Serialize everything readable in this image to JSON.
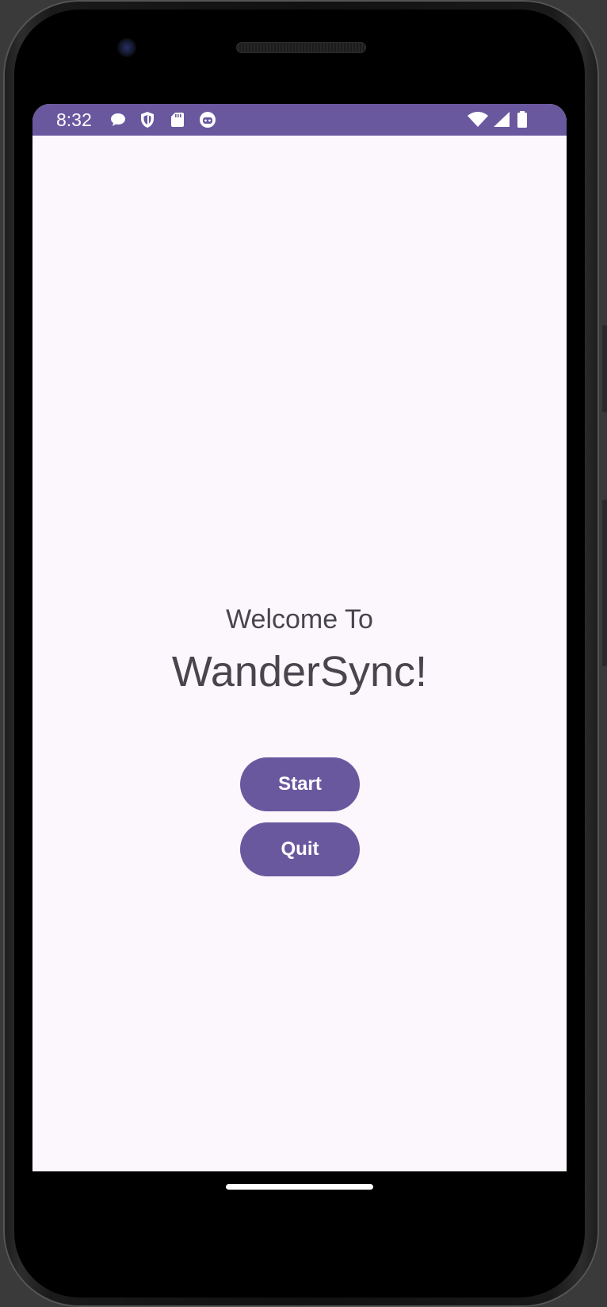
{
  "status_bar": {
    "time": "8:32",
    "background_color": "#6a589f",
    "notification_icons": [
      "chat-bubble-icon",
      "shield-icon",
      "sd-card-icon",
      "robot-face-icon"
    ],
    "system_icons": [
      "wifi-icon",
      "cell-signal-icon",
      "battery-icon"
    ]
  },
  "main": {
    "welcome_text": "Welcome To",
    "app_title": "WanderSync!",
    "start_label": "Start",
    "quit_label": "Quit",
    "button_color": "#6a589f",
    "background_color": "#fcf7fc",
    "text_color": "#49454e"
  }
}
